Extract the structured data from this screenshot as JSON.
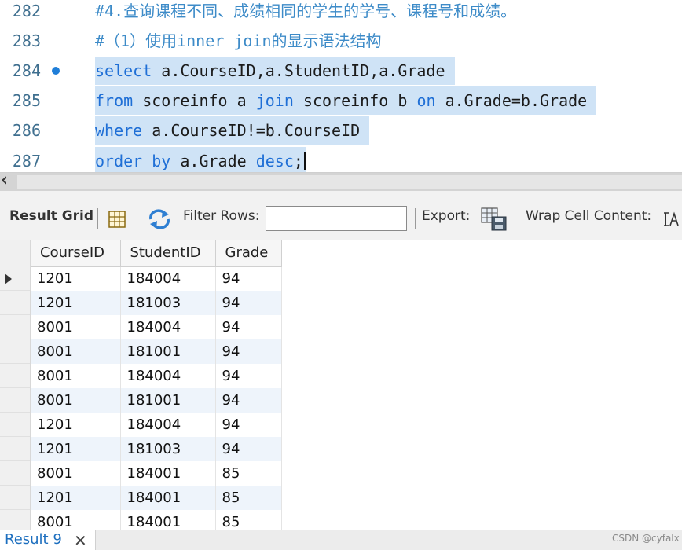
{
  "editor": {
    "lines": [
      {
        "num": "282",
        "text": "#4.查询课程不同、成绩相同的学生的学号、课程号和成绩。"
      },
      {
        "num": "283",
        "text": "#（1）使用inner join的显示语法结构"
      },
      {
        "num": "284",
        "kw1": "select",
        "rest1": " a.CourseID,a.StudentID,a.Grade"
      },
      {
        "num": "285",
        "kw1": "from",
        "rest1": " scoreinfo a ",
        "kw2": "join",
        "rest2": " scoreinfo b ",
        "kw3": "on",
        "rest3": " a.Grade=b.Grade"
      },
      {
        "num": "286",
        "kw1": "where",
        "rest1": " a.CourseID!=b.CourseID"
      },
      {
        "num": "287",
        "kw1": "order by",
        "rest1": " a.Grade ",
        "kw2": "desc",
        "rest2": ";"
      }
    ]
  },
  "toolbar": {
    "result_grid": "Result Grid",
    "filter_rows": "Filter Rows:",
    "filter_value": "",
    "export": "Export:",
    "wrap": "Wrap Cell Content:"
  },
  "grid": {
    "columns": [
      "CourseID",
      "StudentID",
      "Grade"
    ],
    "rows": [
      [
        "1201",
        "184004",
        "94"
      ],
      [
        "1201",
        "181003",
        "94"
      ],
      [
        "8001",
        "184004",
        "94"
      ],
      [
        "8001",
        "181001",
        "94"
      ],
      [
        "8001",
        "184004",
        "94"
      ],
      [
        "8001",
        "181001",
        "94"
      ],
      [
        "1201",
        "184004",
        "94"
      ],
      [
        "1201",
        "181003",
        "94"
      ],
      [
        "8001",
        "184001",
        "85"
      ],
      [
        "1201",
        "184001",
        "85"
      ],
      [
        "8001",
        "184001",
        "85"
      ]
    ]
  },
  "tabs": {
    "result_tab": "Result 9",
    "close": "✕"
  },
  "watermark": "CSDN @cyfalx",
  "colors": {
    "keyword": "#1f6fd6",
    "comment": "#3d8bc8",
    "selection": "#cfe3f6"
  }
}
